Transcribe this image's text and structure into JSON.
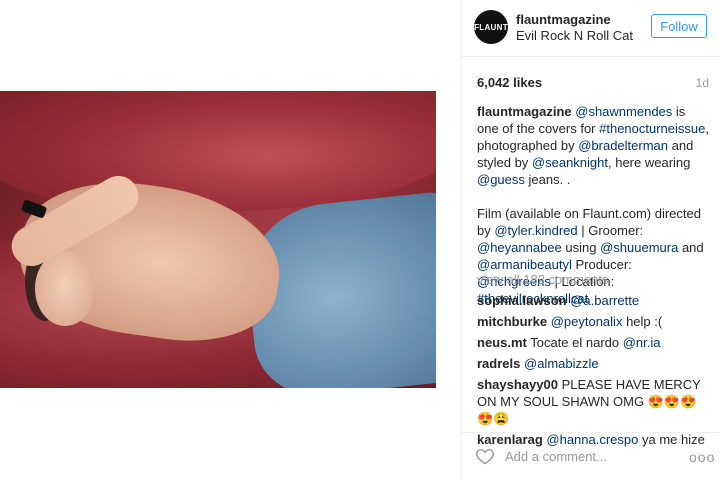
{
  "post": {
    "avatar_text": "FLAUNT",
    "username": "flauntmagazine",
    "location": "Evil Rock N Roll Cat",
    "follow_label": "Follow",
    "likes": "6,042 likes",
    "age": "1d"
  },
  "caption": {
    "user": "flauntmagazine",
    "m_shawn": "@shawnmendes",
    "t1": " is one of the covers for ",
    "h_noct": "#thenocturneissue",
    "t2": ", photographed by ",
    "m_brad": "@bradelterman",
    "t3": " and styled by ",
    "m_sean": "@seanknight",
    "t4": ", here wearing ",
    "m_guess": "@guess",
    "t5": " jeans. .",
    "t6": "Film (available on Flaunt.com) directed by ",
    "m_tyler": "@tyler.kindred",
    "t7": " | Groomer: ",
    "m_heyanna": "@heyannabee",
    "t8": " using ",
    "m_shu": "@shuuemura",
    "t9": " and ",
    "m_armani": "@armanibeautyl",
    "t10": " Producer: ",
    "m_rich": "@richgreens",
    "t11": " | Location: ",
    "h_evil": "#theevilrocknrollcat"
  },
  "view_all": "view all 182 comments",
  "comments": [
    {
      "user": "sophia.lawson",
      "mention": "@a.barrette",
      "text": ""
    },
    {
      "user": "mitchburke",
      "mention": "@peytonalix",
      "text": " help :("
    },
    {
      "user": "neus.mt",
      "text_pre": " Tocate el nardo ",
      "mention": "@nr.ia"
    },
    {
      "user": "radrels",
      "mention": "@almabizzle",
      "text": ""
    },
    {
      "user": "shayshayy00",
      "text": " PLEASE HAVE MERCY ON MY SOUL SHAWN OMG 😍😍😍😍😩"
    },
    {
      "user": "karenlarag",
      "mention": "@hanna.crespo",
      "text": " ya me hize"
    }
  ],
  "footer": {
    "add_comment_placeholder": "Add a comment...",
    "more_label": "ooo"
  },
  "colors": {
    "link": "#003569",
    "follow_blue": "#3897f0",
    "muted": "#999999"
  }
}
